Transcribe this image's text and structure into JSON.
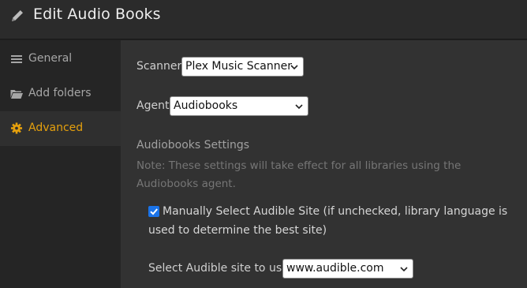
{
  "header": {
    "title": "Edit Audio Books",
    "icon": "pencil-icon"
  },
  "sidebar": {
    "accent": "#e5a00d",
    "items": [
      {
        "label": "General",
        "icon": "list-icon",
        "active": false
      },
      {
        "label": "Add folders",
        "icon": "folder-icon",
        "active": false
      },
      {
        "label": "Advanced",
        "icon": "gear-icon",
        "active": true
      }
    ]
  },
  "main": {
    "scanner": {
      "label": "Scanner",
      "value": "Plex Music Scanner"
    },
    "agent": {
      "label": "Agent",
      "value": "Audiobooks"
    },
    "settings_title": "Audiobooks Settings",
    "note": "Note: These settings will take effect for all libraries using the Audiobooks agent.",
    "manual_select": {
      "checked": true,
      "label": "Manually Select Audible Site (if unchecked, library language is used to determine the best site)"
    },
    "audible_site": {
      "label": "Select Audible site to use:",
      "value": "www.audible.com"
    }
  }
}
